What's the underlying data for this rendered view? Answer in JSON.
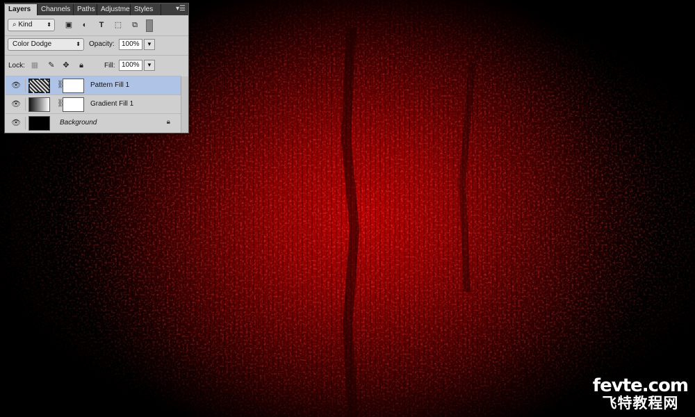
{
  "panel": {
    "tabs": [
      "Layers",
      "Channels",
      "Paths",
      "Adjustme",
      "Styles"
    ],
    "active_tab": "Layers",
    "filter_kind": "Kind",
    "blend_mode": "Color Dodge",
    "opacity_label": "Opacity:",
    "opacity_value": "100%",
    "lock_label": "Lock:",
    "fill_label": "Fill:",
    "fill_value": "100%",
    "layers": [
      {
        "name": "Pattern Fill 1",
        "selected": true,
        "visible": true
      },
      {
        "name": "Gradient Fill 1",
        "selected": false,
        "visible": true
      },
      {
        "name": "Background",
        "selected": false,
        "visible": true,
        "locked": true
      }
    ]
  },
  "watermark": {
    "line1": "fevte.com",
    "line2": "飞特教程网"
  },
  "colors": {
    "canvas_red": "#b50000",
    "selection": "#afc3e6",
    "panel_bg": "#cfcfcf"
  }
}
